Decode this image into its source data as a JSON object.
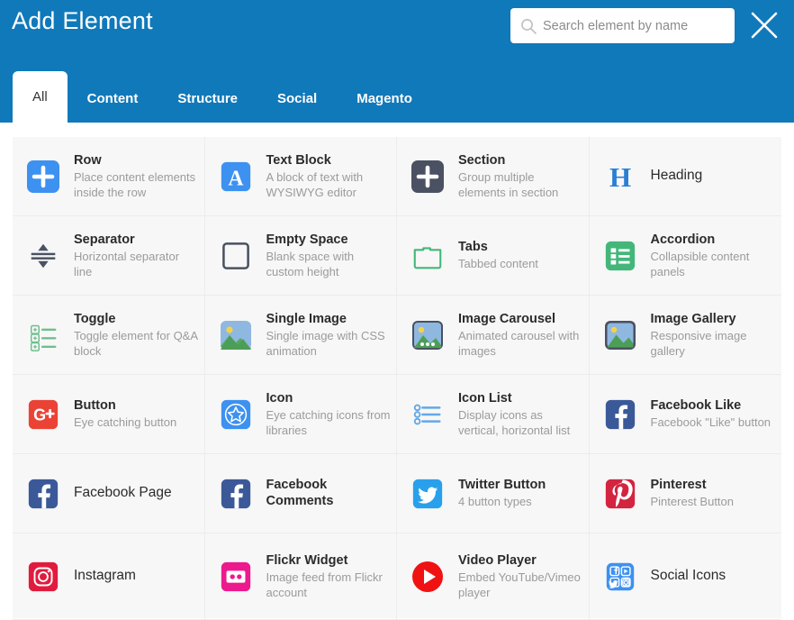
{
  "header": {
    "title": "Add Element",
    "search": {
      "placeholder": "Search element by name",
      "value": "",
      "icon": "search-icon"
    },
    "close_icon": "close-icon",
    "tabs": [
      {
        "label": "All",
        "active": true
      },
      {
        "label": "Content",
        "active": false
      },
      {
        "label": "Structure",
        "active": false
      },
      {
        "label": "Social",
        "active": false
      },
      {
        "label": "Magento",
        "active": false
      }
    ]
  },
  "colors": {
    "header_blue": "#1079ba",
    "grid_background": "#f7f7f7",
    "divider": "#ececec",
    "title_text": "#2b2b2b",
    "desc_text": "#9b9b9b"
  },
  "elements": [
    {
      "name": "Row",
      "description": "Place content elements inside the row",
      "icon": "plus-square-blue-icon"
    },
    {
      "name": "Text Block",
      "description": "A block of text with WYSIWYG editor",
      "icon": "letter-a-blue-icon"
    },
    {
      "name": "Section",
      "description": "Group multiple elements in section",
      "icon": "plus-square-dark-icon"
    },
    {
      "name": "Heading",
      "description": "",
      "icon": "letter-h-serif-blue-icon"
    },
    {
      "name": "Separator",
      "description": "Horizontal separator line",
      "icon": "separator-arrows-icon"
    },
    {
      "name": "Empty Space",
      "description": "Blank space with custom height",
      "icon": "empty-square-outline-icon"
    },
    {
      "name": "Tabs",
      "description": "Tabbed content",
      "icon": "folder-tabs-green-icon"
    },
    {
      "name": "Accordion",
      "description": "Collapsible content panels",
      "icon": "list-square-green-icon"
    },
    {
      "name": "Toggle",
      "description": "Toggle element for Q&A block",
      "icon": "toggle-list-green-icon"
    },
    {
      "name": "Single Image",
      "description": "Single image with CSS animation",
      "icon": "photo-icon"
    },
    {
      "name": "Image Carousel",
      "description": "Animated carousel with images",
      "icon": "photo-carousel-icon"
    },
    {
      "name": "Image Gallery",
      "description": "Responsive image gallery",
      "icon": "photo-gallery-icon"
    },
    {
      "name": "Button",
      "description": "Eye catching button",
      "icon": "google-plus-red-icon"
    },
    {
      "name": "Icon",
      "description": "Eye catching icons from libraries",
      "icon": "star-circle-blue-icon"
    },
    {
      "name": "Icon List",
      "description": "Display icons as vertical, horizontal list",
      "icon": "bullet-list-blue-icon"
    },
    {
      "name": "Facebook Like",
      "description": "Facebook \"Like\" button",
      "icon": "facebook-icon"
    },
    {
      "name": "Facebook Page",
      "description": "",
      "icon": "facebook-icon"
    },
    {
      "name": "Facebook Comments",
      "description": "",
      "icon": "facebook-icon"
    },
    {
      "name": "Twitter Button",
      "description": "4 button types",
      "icon": "twitter-icon"
    },
    {
      "name": "Pinterest",
      "description": "Pinterest Button",
      "icon": "pinterest-icon"
    },
    {
      "name": "Instagram",
      "description": "",
      "icon": "instagram-icon"
    },
    {
      "name": "Flickr Widget",
      "description": "Image feed from Flickr account",
      "icon": "flickr-icon"
    },
    {
      "name": "Video Player",
      "description": "Embed YouTube/Vimeo player",
      "icon": "youtube-play-icon"
    },
    {
      "name": "Social Icons",
      "description": "",
      "icon": "social-grid-blue-icon"
    }
  ]
}
